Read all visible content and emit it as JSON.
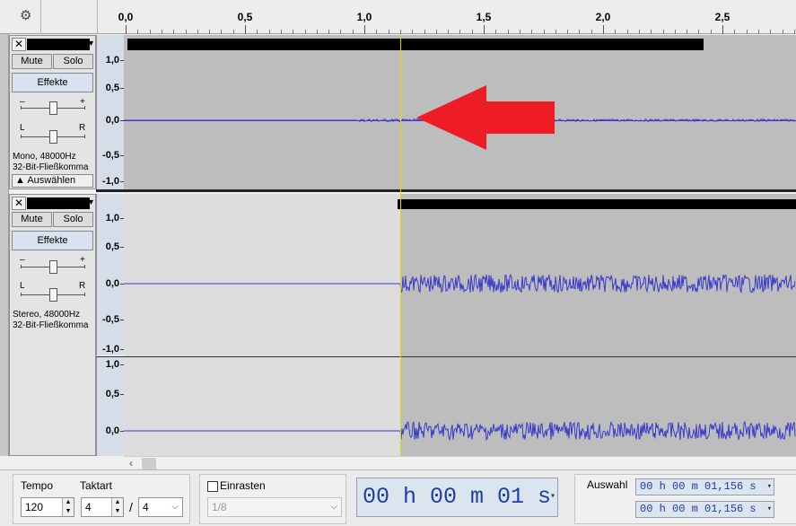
{
  "ruler": {
    "settings_icon": "gear-icon",
    "ticks": [
      "0,0",
      "0,5",
      "1,0",
      "1,5",
      "2,0",
      "2,5"
    ]
  },
  "track1": {
    "close_label": "✕",
    "name": "",
    "mute_label": "Mute",
    "solo_label": "Solo",
    "effects_label": "Effekte",
    "gain_minus": "–",
    "gain_plus": "+",
    "pan_left": "L",
    "pan_right": "R",
    "format_line1": "Mono, 48000Hz",
    "format_line2": "32-Bit-Fließkomma",
    "select_label": "Auswählen",
    "scale": [
      "1,0",
      "0,5",
      "0,0",
      "-0,5",
      "-1,0"
    ]
  },
  "track2": {
    "close_label": "✕",
    "name": "",
    "mute_label": "Mute",
    "solo_label": "Solo",
    "effects_label": "Effekte",
    "gain_minus": "–",
    "gain_plus": "+",
    "pan_left": "L",
    "pan_right": "R",
    "format_line1": "Stereo, 48000Hz",
    "format_line2": "32-Bit-Fließkomma",
    "scale_top": [
      "1,0",
      "0,5",
      "0,0",
      "-0,5",
      "-1,0"
    ],
    "scale_bottom": [
      "1,0",
      "0,5",
      "0,0"
    ]
  },
  "toolbar": {
    "tempo_label": "Tempo",
    "tempo_value": "120",
    "time_sig_label": "Taktart",
    "time_sig_num": "4",
    "time_sig_slash": "/",
    "time_sig_den": "4",
    "snap_label": "Einrasten",
    "snap_checked": false,
    "snap_value": "1/8",
    "audio_position": "00 h 00 m 01 s",
    "selection_label": "Auswahl",
    "selection_start": "00 h 00 m 01,156 s",
    "selection_end": "00 h 00 m 01,156 s"
  },
  "colors": {
    "waveform": "#3a3acb",
    "cursor": "#e0d800",
    "annotation_arrow": "#ee1c25",
    "time_text": "#1d3fa6"
  }
}
